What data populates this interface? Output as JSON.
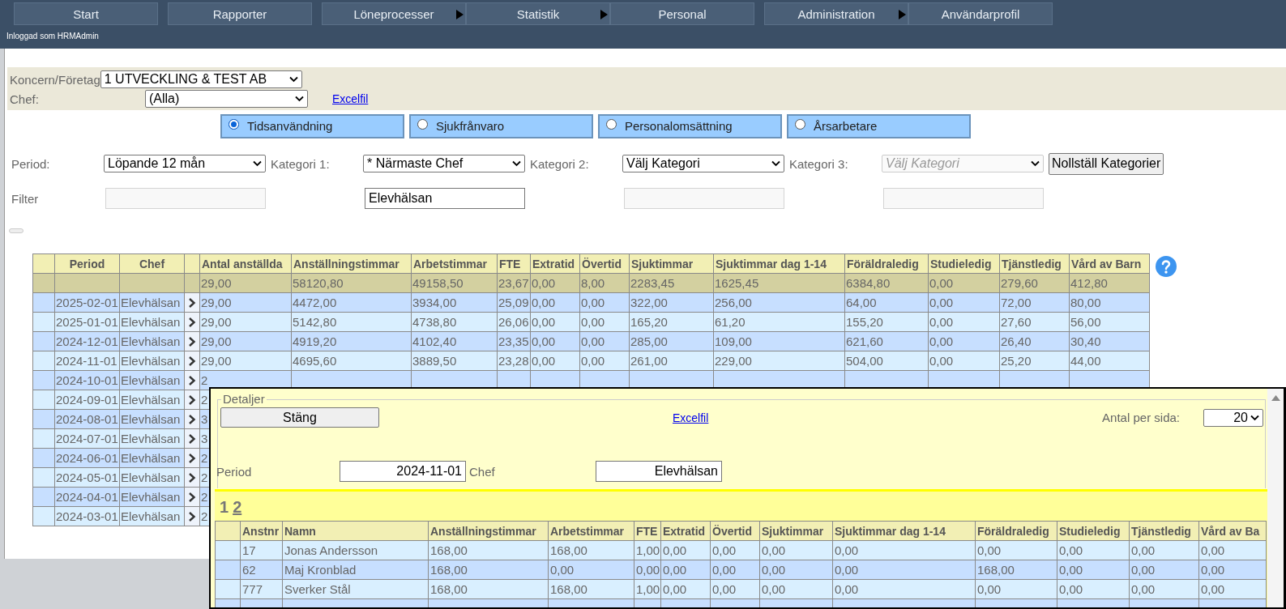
{
  "nav": [
    {
      "label": "Start",
      "has_submenu": false
    },
    {
      "label": "Rapporter",
      "has_submenu": false
    },
    {
      "label": "Löneprocesser",
      "has_submenu": true
    },
    {
      "label": "Statistik",
      "has_submenu": true
    },
    {
      "label": "Personal",
      "has_submenu": false
    },
    {
      "label": "Administration",
      "has_submenu": true
    },
    {
      "label": "Användarprofil",
      "has_submenu": false
    }
  ],
  "logged_in": "Inloggad som HRMAdmin",
  "company": {
    "label": "Koncern/Företag",
    "value": "1 UTVECKLING & TEST AB"
  },
  "chef": {
    "label": "Chef:",
    "value": "(Alla)",
    "link": "Excelfil"
  },
  "report_types": [
    {
      "label": "Tidsanvändning",
      "selected": true
    },
    {
      "label": "Sjukfrånvaro",
      "selected": false
    },
    {
      "label": "Personalomsättning",
      "selected": false
    },
    {
      "label": "Årsarbetare",
      "selected": false
    }
  ],
  "period_row": [
    {
      "label": "Period:",
      "value": "Löpande 12 mån",
      "disabled": false
    },
    {
      "label": "Kategori 1:",
      "value": "* Närmaste Chef",
      "disabled": false
    },
    {
      "label": "Kategori 2:",
      "value": "Välj Kategori",
      "disabled": false
    },
    {
      "label": "Kategori 3:",
      "value": "Välj Kategori",
      "disabled": true
    }
  ],
  "reset_button": "Nollställ Kategorier",
  "filter": {
    "label": "Filter",
    "fields": [
      {
        "disabled": true
      },
      {
        "value": "Elevhälsan",
        "disabled": false
      },
      {
        "disabled": true
      },
      {
        "disabled": true
      }
    ]
  },
  "table": {
    "columns": [
      "Period",
      "Chef",
      "",
      "Antal anställda",
      "Anställningstimmar",
      "Arbetstimmar",
      "FTE",
      "Extratid",
      "Övertid",
      "Sjuktimmar",
      "Sjuktimmar dag 1-14",
      "Föräldraledig",
      "Studieledig",
      "Tjänstledig",
      "Vård av Barn"
    ],
    "totals": [
      "29,00",
      "58120,80",
      "49158,50",
      "23,67",
      "0,00",
      "8,00",
      "2283,45",
      "1625,45",
      "6384,80",
      "0,00",
      "279,60",
      "412,80"
    ],
    "rows": [
      {
        "period": "2025-02-01",
        "chef": "Elevhälsan",
        "values": [
          "29,00",
          "4472,00",
          "3934,00",
          "25,09",
          "0,00",
          "0,00",
          "322,00",
          "256,00",
          "64,00",
          "0,00",
          "72,00",
          "80,00"
        ]
      },
      {
        "period": "2025-01-01",
        "chef": "Elevhälsan",
        "values": [
          "29,00",
          "5142,80",
          "4738,80",
          "26,06",
          "0,00",
          "0,00",
          "165,20",
          "61,20",
          "155,20",
          "0,00",
          "27,60",
          "56,00"
        ]
      },
      {
        "period": "2024-12-01",
        "chef": "Elevhälsan",
        "values": [
          "29,00",
          "4919,20",
          "4102,40",
          "23,35",
          "0,00",
          "0,00",
          "285,00",
          "109,00",
          "621,60",
          "0,00",
          "26,40",
          "30,40"
        ]
      },
      {
        "period": "2024-11-01",
        "chef": "Elevhälsan",
        "values": [
          "29,00",
          "4695,60",
          "3889,50",
          "23,28",
          "0,00",
          "0,00",
          "261,00",
          "229,00",
          "504,00",
          "0,00",
          "25,20",
          "44,00"
        ]
      },
      {
        "period": "2024-10-01",
        "chef": "Elevhälsan",
        "values": [
          "2"
        ]
      },
      {
        "period": "2024-09-01",
        "chef": "Elevhälsan",
        "values": [
          "2"
        ]
      },
      {
        "period": "2024-08-01",
        "chef": "Elevhälsan",
        "values": [
          "3"
        ]
      },
      {
        "period": "2024-07-01",
        "chef": "Elevhälsan",
        "values": [
          "3"
        ]
      },
      {
        "period": "2024-06-01",
        "chef": "Elevhälsan",
        "values": [
          "2"
        ]
      },
      {
        "period": "2024-05-01",
        "chef": "Elevhälsan",
        "values": [
          "2"
        ]
      },
      {
        "period": "2024-04-01",
        "chef": "Elevhälsan",
        "values": [
          "2"
        ]
      },
      {
        "period": "2024-03-01",
        "chef": "Elevhälsan",
        "values": [
          "2"
        ]
      }
    ]
  },
  "details": {
    "legend": "Detaljer",
    "close": "Stäng",
    "link": "Excelfil",
    "per_page_label": "Antal per sida:",
    "per_page": "20",
    "period_label": "Period",
    "period": "2024-11-01",
    "chef_label": "Chef",
    "chef": "Elevhälsan",
    "pages": [
      {
        "label": "1",
        "selected": true
      },
      {
        "label": "2",
        "selected": false
      }
    ],
    "columns": [
      "Anstnr",
      "Namn",
      "Anställningstimmar",
      "Arbetstimmar",
      "FTE",
      "Extratid",
      "Övertid",
      "Sjuktimmar",
      "Sjuktimmar dag 1-14",
      "Föräldraledig",
      "Studieledig",
      "Tjänstledig",
      "Vård av Ba"
    ],
    "rows": [
      {
        "cells": [
          "17",
          "Jonas Andersson",
          "168,00",
          "168,00",
          "1,00",
          "0,00",
          "0,00",
          "0,00",
          "0,00",
          "0,00",
          "0,00",
          "0,00",
          "0,00"
        ]
      },
      {
        "cells": [
          "62",
          "Maj Kronblad",
          "168,00",
          "0,00",
          "0,00",
          "0,00",
          "0,00",
          "0,00",
          "0,00",
          "168,00",
          "0,00",
          "0,00",
          "0,00"
        ]
      },
      {
        "cells": [
          "777",
          "Sverker Stål",
          "168,00",
          "168,00",
          "1,00",
          "0,00",
          "0,00",
          "0,00",
          "0,00",
          "0,00",
          "0,00",
          "0,00",
          "0,00"
        ]
      },
      {
        "cells": []
      }
    ]
  }
}
